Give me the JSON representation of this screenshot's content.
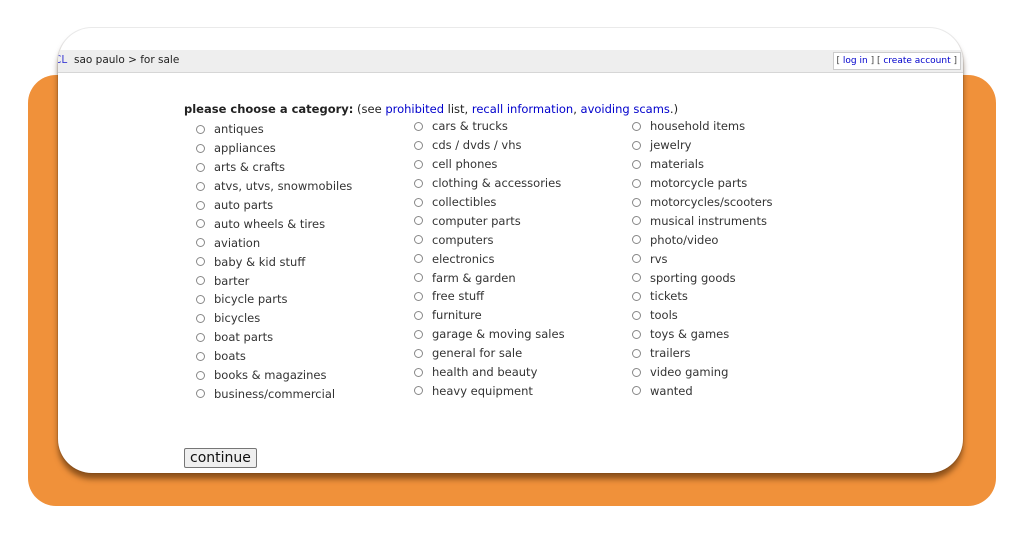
{
  "header": {
    "logo": "CL",
    "breadcrumb": "sao paulo > for sale",
    "account": {
      "open": "[ ",
      "login": "log in",
      "mid": " ] [ ",
      "create": "create account",
      "close": " ]"
    }
  },
  "form": {
    "heading_bold": "please choose a category:",
    "heading_pre": " (see ",
    "link_prohibited": "prohibited",
    "text_list": " list, ",
    "link_recall": "recall information",
    "text_comma": ", ",
    "link_scams": "avoiding scams",
    "text_end": ".)",
    "continue_label": "continue",
    "columns": [
      [
        "antiques",
        "appliances",
        "arts & crafts",
        "atvs, utvs, snowmobiles",
        "auto parts",
        "auto wheels & tires",
        "aviation",
        "baby & kid stuff",
        "barter",
        "bicycle parts",
        "bicycles",
        "boat parts",
        "boats",
        "books & magazines",
        "business/commercial"
      ],
      [
        "cars & trucks",
        "cds / dvds / vhs",
        "cell phones",
        "clothing & accessories",
        "collectibles",
        "computer parts",
        "computers",
        "electronics",
        "farm & garden",
        "free stuff",
        "furniture",
        "garage & moving sales",
        "general for sale",
        "health and beauty",
        "heavy equipment"
      ],
      [
        "household items",
        "jewelry",
        "materials",
        "motorcycle parts",
        "motorcycles/scooters",
        "musical instruments",
        "photo/video",
        "rvs",
        "sporting goods",
        "tickets",
        "tools",
        "toys & games",
        "trailers",
        "video gaming",
        "wanted"
      ]
    ]
  }
}
